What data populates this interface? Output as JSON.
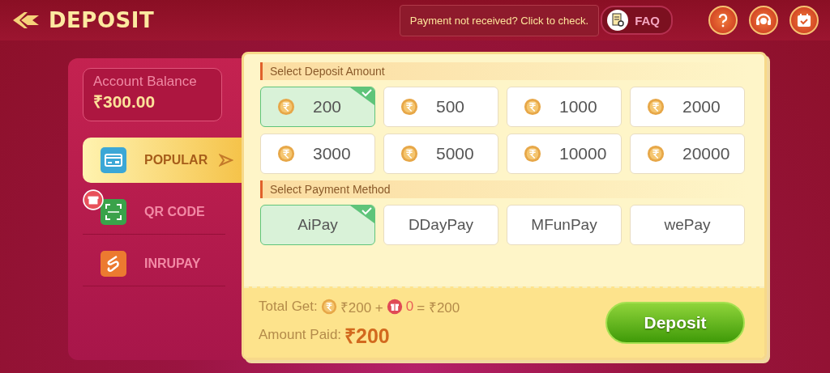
{
  "header": {
    "title": "DEPOSIT",
    "notice": "Payment not received? Click to check.",
    "faq": "FAQ"
  },
  "balance": {
    "label": "Account Balance",
    "value": "₹300.00"
  },
  "methods_nav": [
    {
      "label": "POPULAR",
      "selected": true,
      "gift": false
    },
    {
      "label": "QR CODE",
      "selected": false,
      "gift": true
    },
    {
      "label": "INRUPAY",
      "selected": false,
      "gift": false
    }
  ],
  "amount_section": {
    "title": "Select Deposit Amount",
    "amounts": [
      {
        "value": "200",
        "selected": true
      },
      {
        "value": "500",
        "selected": false
      },
      {
        "value": "1000",
        "selected": false
      },
      {
        "value": "2000",
        "selected": false
      },
      {
        "value": "3000",
        "selected": false
      },
      {
        "value": "5000",
        "selected": false
      },
      {
        "value": "10000",
        "selected": false
      },
      {
        "value": "20000",
        "selected": false
      }
    ]
  },
  "payment_section": {
    "title": "Select Payment Method",
    "channels": [
      {
        "name": "AiPay",
        "selected": true
      },
      {
        "name": "DDayPay",
        "selected": false
      },
      {
        "name": "MFunPay",
        "selected": false
      },
      {
        "name": "wePay",
        "selected": false
      }
    ]
  },
  "summary": {
    "total_label": "Total Get:",
    "base": "₹200 +",
    "bonus": "0",
    "total": "= ₹200",
    "paid_label": "Amount Paid:",
    "paid": "₹200"
  },
  "deposit_button": "Deposit"
}
